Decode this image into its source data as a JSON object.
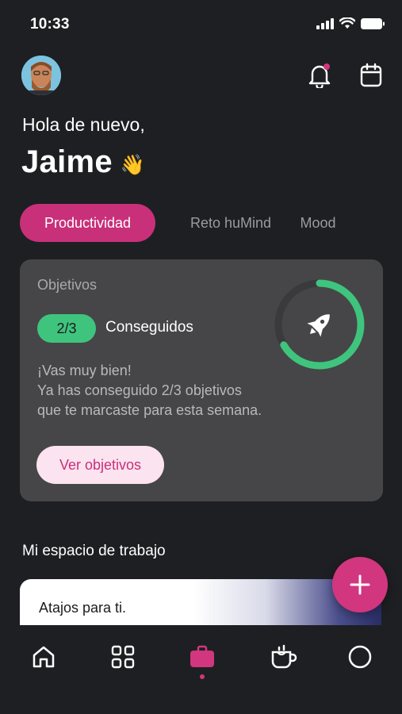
{
  "status_bar": {
    "time": "10:33"
  },
  "header": {
    "greeting": "Hola de nuevo,",
    "user_name": "Jaime",
    "wave_emoji": "👋"
  },
  "tabs": [
    {
      "label": "Productividad",
      "active": true
    },
    {
      "label": "Reto huMind",
      "active": false
    },
    {
      "label": "Mood",
      "active": false
    }
  ],
  "goals_card": {
    "title": "Objetivos",
    "badge": "2/3",
    "badge_label": "Conseguidos",
    "message_lines": [
      "¡Vas muy bien!",
      "Ya has conseguido 2/3 objetivos",
      "que te marcaste para esta semana."
    ],
    "button_label": "Ver objetivos",
    "progress_fraction": 0.6667,
    "progress_icon": "rocket-icon"
  },
  "workspace": {
    "section_title": "Mi espacio de trabajo",
    "shortcuts_label": "Atajos para ti."
  },
  "bottom_nav": {
    "items": [
      "home-icon",
      "grid-icon",
      "briefcase-icon",
      "coffee-icon",
      "circle-icon"
    ],
    "active_index": 2
  },
  "colors": {
    "background": "#1e1f22",
    "accent_pink": "#c8307a",
    "success_green": "#3fc47e",
    "card": "#464648"
  }
}
